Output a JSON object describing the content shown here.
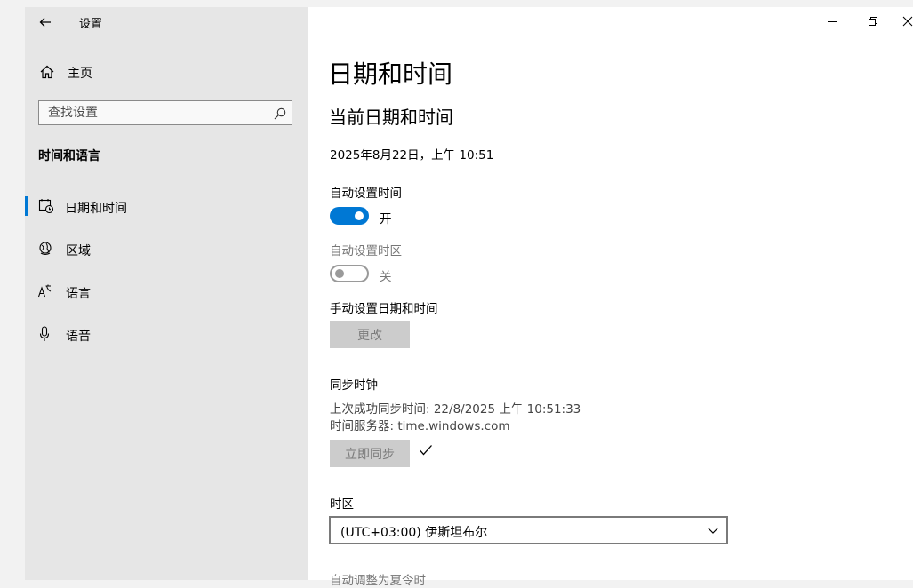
{
  "window": {
    "title": "设置"
  },
  "sidebar": {
    "home_label": "主页",
    "search": {
      "placeholder": "查找设置"
    },
    "section_title": "时间和语言",
    "items": [
      {
        "label": "日期和时间",
        "icon": "calendar-clock-icon",
        "active": true
      },
      {
        "label": "区域",
        "icon": "globe-icon",
        "active": false
      },
      {
        "label": "语言",
        "icon": "language-icon",
        "active": false
      },
      {
        "label": "语音",
        "icon": "microphone-icon",
        "active": false
      }
    ]
  },
  "main": {
    "page_title": "日期和时间",
    "current_heading": "当前日期和时间",
    "current_datetime": "2025年8月22日，上午 10:51",
    "auto_time": {
      "label": "自动设置时间",
      "state": "开",
      "on": true
    },
    "auto_timezone": {
      "label": "自动设置时区",
      "state": "关",
      "on": false
    },
    "manual": {
      "label": "手动设置日期和时间",
      "button": "更改"
    },
    "sync": {
      "heading": "同步时钟",
      "last_sync": "上次成功同步时间: 22/8/2025 上午 10:51:33",
      "server": "时间服务器: time.windows.com",
      "button": "立即同步",
      "status_icon": "checkmark-icon"
    },
    "timezone": {
      "label": "时区",
      "value": "(UTC+03:00) 伊斯坦布尔"
    },
    "dst_label": "自动调整为夏令时"
  },
  "colors": {
    "accent": "#0078d4",
    "sidebar_bg": "#e6e6e6",
    "disabled_button": "#cccccc"
  }
}
